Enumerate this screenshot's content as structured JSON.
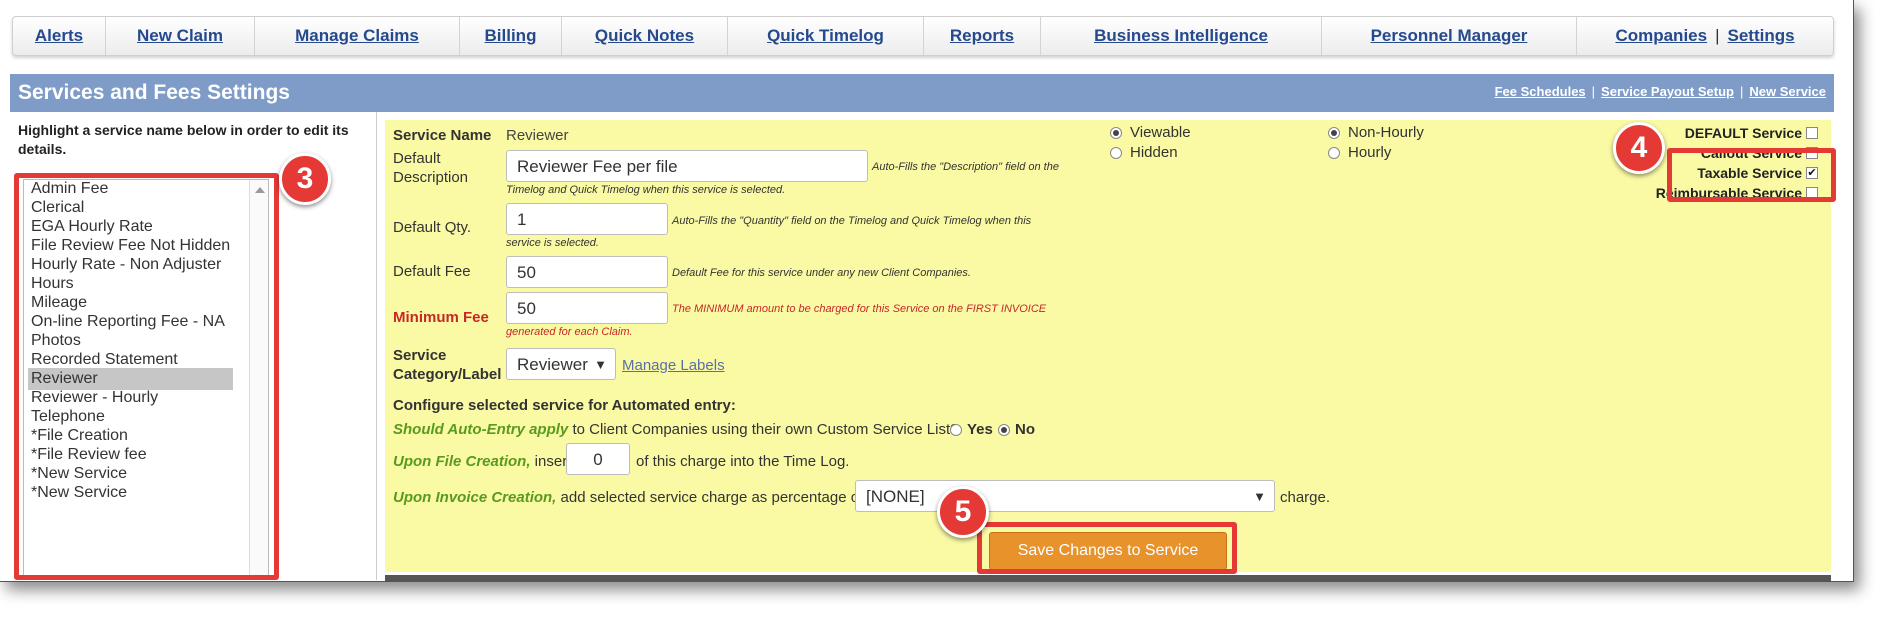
{
  "nav": {
    "items": [
      "Alerts",
      "New Claim",
      "Manage Claims",
      "Billing",
      "Quick Notes",
      "Quick Timelog",
      "Reports",
      "Business Intelligence",
      "Personnel Manager"
    ],
    "companies": "Companies",
    "separator": "|",
    "settings": "Settings"
  },
  "header": {
    "title": "Services and Fees Settings",
    "links": [
      "Fee Schedules",
      "Service Payout Setup",
      "New Service"
    ],
    "separator": "|"
  },
  "left": {
    "hint": "Highlight a service name below in order to edit its details.",
    "services": [
      "Admin Fee",
      "Clerical",
      "EGA Hourly Rate",
      "File Review Fee Not Hidden",
      "Hourly Rate - Non Adjuster",
      "Hours",
      "Mileage",
      "On-line Reporting Fee - NA",
      "Photos",
      "Recorded Statement",
      "Reviewer",
      "Reviewer - Hourly",
      "Telephone",
      "*File Creation",
      "*File Review fee",
      "*New Service",
      "*New Service"
    ],
    "selected_service": "Reviewer"
  },
  "form": {
    "service_name_label": "Service Name",
    "service_name_value": "Reviewer",
    "default_description_label_1": "Default",
    "default_description_label_2": "Description",
    "default_description_value": "Reviewer Fee per file",
    "default_description_note_1": "Auto-Fills the \"Description\" field on the",
    "default_description_note_2": "Timelog and Quick Timelog when this service is selected.",
    "default_qty_label": "Default Qty.",
    "default_qty_value": "1",
    "default_qty_note_1": "Auto-Fills the \"Quantity\" field on the Timelog and Quick Timelog when this",
    "default_qty_note_2": "service is selected.",
    "default_fee_label": "Default Fee",
    "default_fee_value": "50",
    "default_fee_note": "Default Fee for this service under any new Client Companies.",
    "minimum_fee_label": "Minimum Fee",
    "minimum_fee_value": "50",
    "minimum_fee_note_1": "The MINIMUM amount to be charged for this Service on the FIRST INVOICE",
    "minimum_fee_note_2": "generated for each Claim.",
    "category_label_1": "Service",
    "category_label_2": "Category/Label",
    "category_value": "Reviewer",
    "manage_labels": "Manage Labels",
    "visibility_options": [
      "Viewable",
      "Hidden"
    ],
    "visibility_selected": "Viewable",
    "billing_options": [
      "Non-Hourly",
      "Hourly"
    ],
    "billing_selected": "Non-Hourly",
    "flags": [
      {
        "label": "DEFAULT Service",
        "checked": false
      },
      {
        "label": "Callout Service",
        "checked": false
      },
      {
        "label": "Taxable Service",
        "checked": true
      },
      {
        "label": "Reimbursable Service",
        "checked": false
      }
    ],
    "auto_heading": "Configure selected service for Automated entry:",
    "auto_entry_green": "Should Auto-Entry apply",
    "auto_entry_rest": " to Client Companies using their own Custom Service List?",
    "yes": "Yes",
    "no": "No",
    "auto_entry_selected": "No",
    "file_creation_green": "Upon File Creation,",
    "file_creation_insert": " insert",
    "file_creation_value": "0",
    "file_creation_rest": "of this charge into the Time Log.",
    "invoice_green": "Upon Invoice Creation,",
    "invoice_rest": " add selected service charge as percentage of",
    "invoice_value": "[NONE]",
    "invoice_tail": "charge.",
    "save_button": "Save Changes to Service"
  },
  "annotations": [
    "3",
    "4",
    "5"
  ],
  "colors": {
    "header_blue": "#7e9cc7",
    "panel_yellow": "#fafaa5",
    "accent_red": "#e53935",
    "save_orange": "#e8922b",
    "link_blue": "#24498d"
  }
}
